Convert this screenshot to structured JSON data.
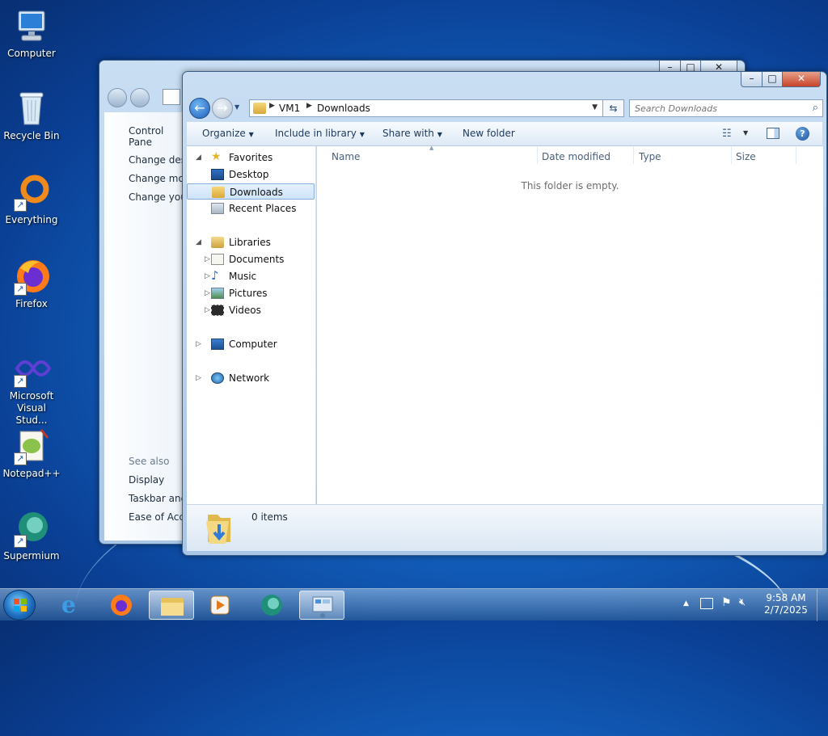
{
  "desktop": {
    "icons": [
      {
        "label": "Computer"
      },
      {
        "label": "Recycle Bin"
      },
      {
        "label": "Everything"
      },
      {
        "label": "Firefox"
      },
      {
        "label": "Microsoft Visual Stud..."
      },
      {
        "label": "Notepad++"
      },
      {
        "label": "Supermium"
      }
    ]
  },
  "back_window": {
    "sidebar_items": [
      "Control Pane",
      "Change desk",
      "Change mou",
      "Change you"
    ],
    "see_also_title": "See also",
    "see_also_items": [
      "Display",
      "Taskbar and",
      "Ease of Acce"
    ]
  },
  "explorer": {
    "breadcrumb": [
      "VM1",
      "Downloads"
    ],
    "search_placeholder": "Search Downloads",
    "toolbar": {
      "organize": "Organize",
      "include_in_library": "Include in library",
      "share_with": "Share with",
      "new_folder": "New folder"
    },
    "nav": {
      "favorites": "Favorites",
      "desktop": "Desktop",
      "downloads": "Downloads",
      "recent_places": "Recent Places",
      "libraries": "Libraries",
      "documents": "Documents",
      "music": "Music",
      "pictures": "Pictures",
      "videos": "Videos",
      "computer": "Computer",
      "network": "Network"
    },
    "columns": [
      "Name",
      "Date modified",
      "Type",
      "Size"
    ],
    "empty_message": "This folder is empty.",
    "status_items": "0 items"
  },
  "taskbar": {
    "time": "9:58 AM",
    "date": "2/7/2025"
  }
}
